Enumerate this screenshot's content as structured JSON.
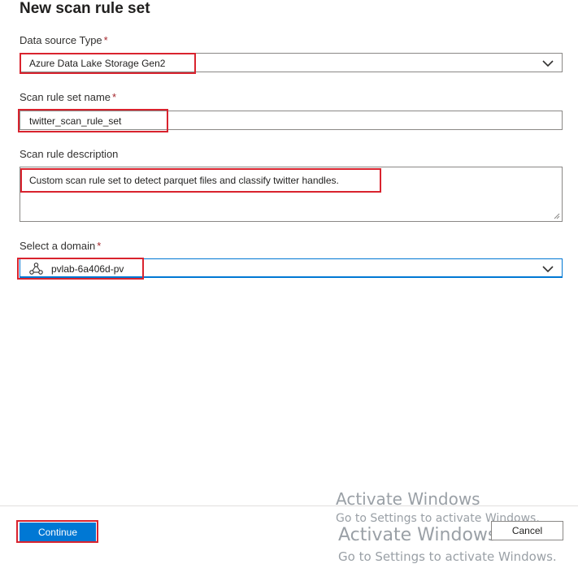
{
  "panel": {
    "title": "New scan rule set"
  },
  "data_source_type": {
    "label": "Data source Type",
    "required_mark": "*",
    "value": "Azure Data Lake Storage Gen2"
  },
  "scan_rule_set_name": {
    "label": "Scan rule set name",
    "required_mark": "*",
    "value": "twitter_scan_rule_set"
  },
  "scan_rule_description": {
    "label": "Scan rule description",
    "value": "Custom scan rule set to detect parquet files and classify twitter handles."
  },
  "domain": {
    "label": "Select a domain",
    "required_mark": "*",
    "value": "pvlab-6a406d-pv",
    "icon": "domain-network-icon"
  },
  "footer": {
    "continue_label": "Continue",
    "cancel_label": "Cancel"
  },
  "watermark": {
    "line1": "Activate Windows",
    "line2": "Go to Settings to activate Windows.",
    "line3": "Activate Windows",
    "line4": "Go to Settings to activate Windows."
  },
  "colors": {
    "highlight": "#d9232e",
    "primary": "#0078d4",
    "required": "#a4262c"
  }
}
